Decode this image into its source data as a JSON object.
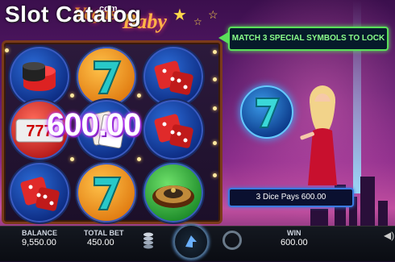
{
  "watermark": {
    "text": "Slot Catalog"
  },
  "game_logo": {
    "com": ".com",
    "word1": "Vegas",
    "word2": "Baby"
  },
  "reels": [
    [
      "chips",
      "seven",
      "dice"
    ],
    [
      "slot-sevens",
      "cards",
      "dice"
    ],
    [
      "dice",
      "seven",
      "roulette"
    ]
  ],
  "win_amount": "600.00",
  "banner": {
    "text": "MATCH 3 SPECIAL SYMBOLS TO LOCK"
  },
  "pays_message": "3 Dice Pays 600.00",
  "bottom_bar": {
    "balance_label": "BALANCE",
    "balance_value": "9,550.00",
    "total_bet_label": "TOTAL BET",
    "total_bet_value": "450.00",
    "win_label": "WIN",
    "win_value": "600.00"
  },
  "colors": {
    "banner_border": "#5ae05a",
    "win_glow": "#c040ff",
    "pays_border": "#3a7ae0"
  },
  "icons": [
    "coin-stack-icon",
    "spin-icon",
    "autoplay-icon",
    "sound-icon"
  ]
}
